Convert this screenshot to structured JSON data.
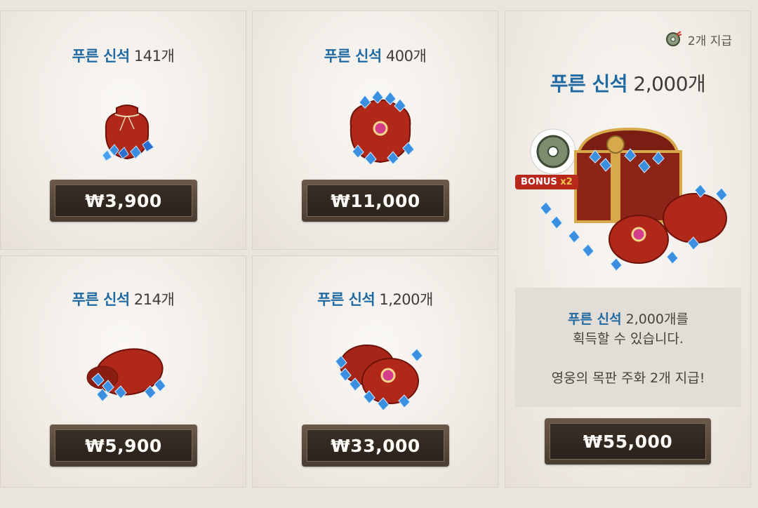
{
  "cards": [
    {
      "title_hl": "푸른 신석",
      "title_rest": " 141개",
      "price": "₩3,900"
    },
    {
      "title_hl": "푸른 신석",
      "title_rest": " 400개",
      "price": "₩11,000"
    },
    {
      "title_hl": "푸른 신석",
      "title_rest": " 214개",
      "price": "₩5,900"
    },
    {
      "title_hl": "푸른 신석",
      "title_rest": " 1,200개",
      "price": "₩33,000"
    }
  ],
  "featured": {
    "title_hl": "푸른 신석",
    "title_rest": " 2,000개",
    "badge_text": "2개 지급",
    "bonus_label": "BONUS",
    "bonus_multiplier": "x2",
    "desc_hl": "푸른 신석",
    "desc_line1_rest": " 2,000개를",
    "desc_line2": "획득할 수 있습니다.",
    "desc_line3": "영웅의 목판 주화 2개 지급!",
    "price": "₩55,000"
  },
  "colors": {
    "accent_blue": "#1f6aa3",
    "button_dark": "#2a221c",
    "bonus_red": "#c0392b"
  },
  "icons": [
    "coin-icon",
    "gem-pouch-icon",
    "treasure-chest-icon"
  ]
}
